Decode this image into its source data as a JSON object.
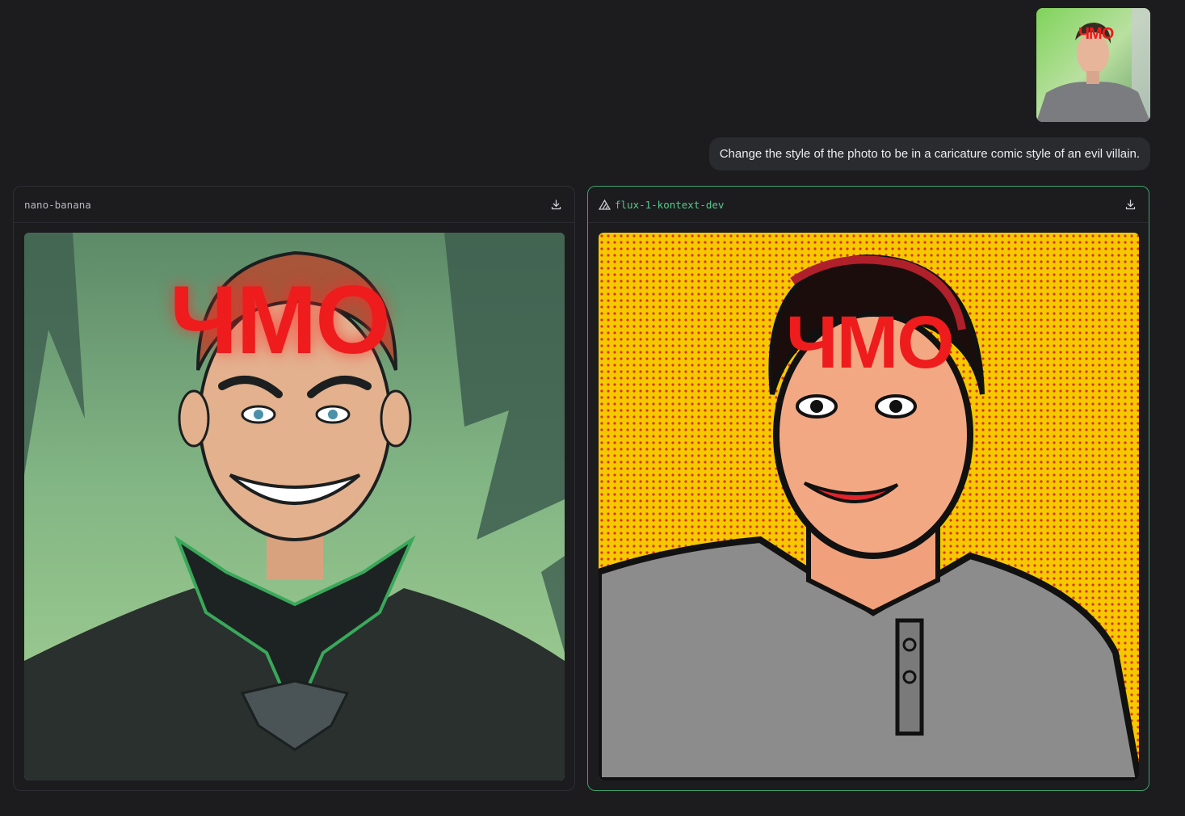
{
  "user_message": {
    "attachment_watermark": "ЧМО",
    "prompt": "Change the style of the photo to be in a caricature comic style of an evil villain."
  },
  "results": [
    {
      "model": "nano-banana",
      "image_watermark": "ЧМО",
      "download_icon": "download-icon"
    },
    {
      "model": "flux-1-kontext-dev",
      "model_icon": "triangle-logo-icon",
      "image_watermark": "ЧМО",
      "download_icon": "download-icon",
      "selected": true,
      "accent_color": "#57c98a"
    }
  ],
  "colors": {
    "background": "#1c1c1f",
    "bubble": "#2a2b2f",
    "selected_border": "#3f9f6b"
  }
}
